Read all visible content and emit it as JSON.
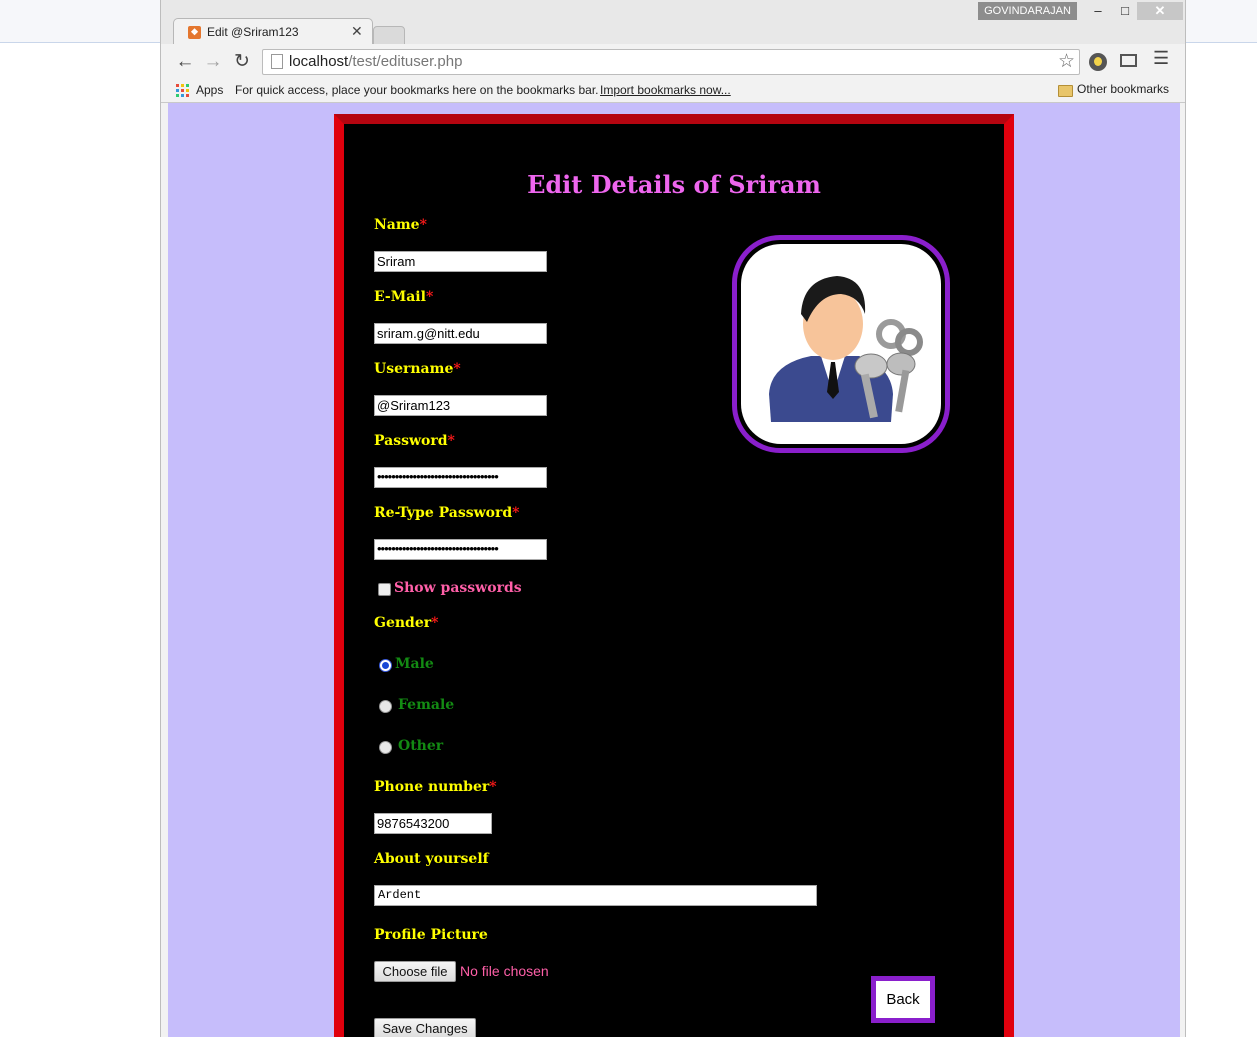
{
  "browser": {
    "user_name": "GOVINDARAJAN",
    "tab_title": "Edit @Sriram123",
    "url_host": "localhost",
    "url_path": "/test/edituser.php",
    "bookmarks_bar": {
      "apps_label": "Apps",
      "hint": "For quick access, place your bookmarks here on the bookmarks bar.",
      "import_link": "Import bookmarks now...",
      "other_bookmarks": "Other bookmarks"
    }
  },
  "colors": {
    "page_background": "#c6bdfb",
    "panel_border": "#e0000d",
    "title": "#ee66ee",
    "labels": "#ffff00",
    "required_star": "#ff1a1a",
    "radio_labels": "#138a13",
    "accent_border": "#8a1fcc"
  },
  "form": {
    "title": "Edit Details of Sriram",
    "required_mark": "*",
    "name": {
      "label": "Name",
      "value": "Sriram"
    },
    "email": {
      "label": "E-Mail",
      "value": "sriram.g@nitt.edu"
    },
    "username": {
      "label": "Username",
      "value": "@Sriram123"
    },
    "password": {
      "label": "Password",
      "masked": "••••••••••••••••••••••••••••••••••"
    },
    "retype_password": {
      "label": "Re-Type Password",
      "masked": "••••••••••••••••••••••••••••••••••"
    },
    "show_passwords": {
      "label": "Show passwords",
      "checked": false
    },
    "gender": {
      "label": "Gender",
      "options": [
        {
          "label": "Male",
          "selected": true
        },
        {
          "label": "Female",
          "selected": false
        },
        {
          "label": "Other",
          "selected": false
        }
      ]
    },
    "phone": {
      "label": "Phone number",
      "value": "9876543200"
    },
    "about": {
      "label": "About yourself",
      "value": "Ardent"
    },
    "profile_picture": {
      "label": "Profile Picture",
      "button": "Choose file",
      "status": "No file chosen"
    },
    "save_button": "Save Changes",
    "back_button": "Back",
    "avatar_icon": "user-with-keys-icon"
  }
}
